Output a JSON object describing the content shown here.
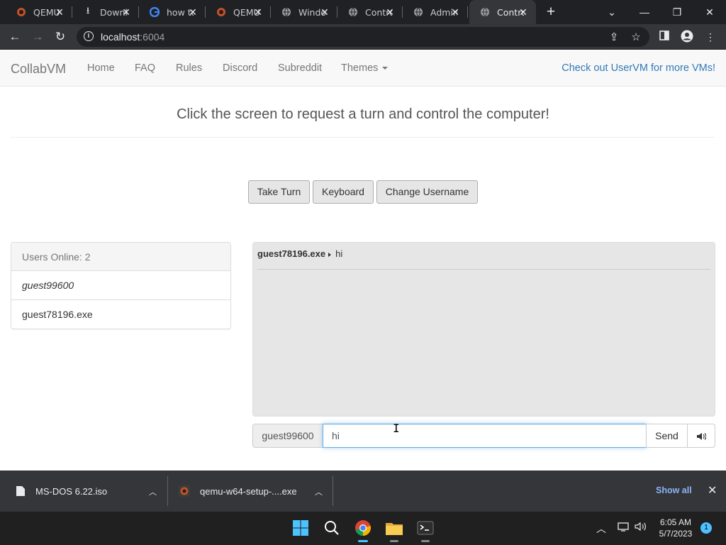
{
  "browser": {
    "tabs": [
      {
        "title": "QEMU",
        "icon": "qemu-icon"
      },
      {
        "title": "Downloads",
        "icon": "download-icon"
      },
      {
        "title": "how to",
        "icon": "google-icon"
      },
      {
        "title": "QEMU",
        "icon": "qemu-icon"
      },
      {
        "title": "Windows",
        "icon": "globe-icon"
      },
      {
        "title": "Control",
        "icon": "globe-icon"
      },
      {
        "title": "Admin",
        "icon": "globe-icon"
      },
      {
        "title": "Control",
        "icon": "globe-icon",
        "active": true
      }
    ],
    "url_host": "localhost",
    "url_port": ":6004"
  },
  "site": {
    "brand": "CollabVM",
    "nav": [
      "Home",
      "FAQ",
      "Rules",
      "Discord",
      "Subreddit",
      "Themes"
    ],
    "promo": "Check out UserVM for more VMs!",
    "headline": "Click the screen to request a turn and control the computer!",
    "buttons": {
      "take_turn": "Take Turn",
      "keyboard": "Keyboard",
      "change_username": "Change Username"
    },
    "users_header": "Users Online: 2",
    "users": [
      "guest99600",
      "guest78196.exe"
    ],
    "chat": [
      {
        "user": "guest78196.exe",
        "text": "hi"
      }
    ],
    "chat_username": "guest99600",
    "chat_input_value": "hi",
    "send_label": "Send"
  },
  "downloads": {
    "items": [
      "MS-DOS 6.22.iso",
      "qemu-w64-setup-....exe"
    ],
    "show_all": "Show all"
  },
  "taskbar": {
    "time": "6:05 AM",
    "date": "5/7/2023",
    "notifications": "1"
  },
  "colors": {
    "accent_link": "#337ab7",
    "chrome_dark": "#202124",
    "input_focus": "#66afe9"
  }
}
